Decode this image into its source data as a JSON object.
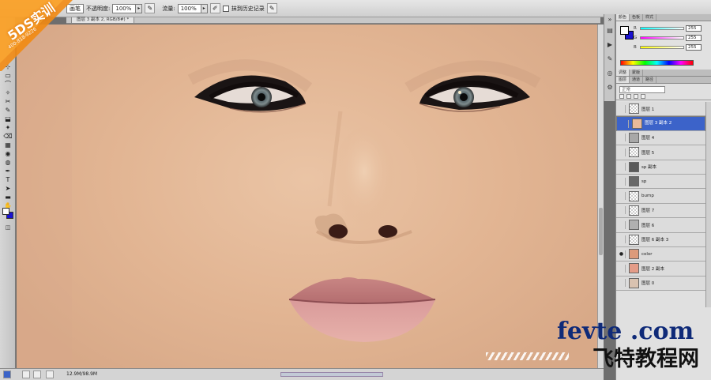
{
  "options_bar": {
    "brush_mode": "画笔",
    "opacity_label": "不透明度:",
    "opacity_value": "100%",
    "flow_label": "流量:",
    "flow_value": "100%",
    "erase_history_label": "抹到历史记录"
  },
  "document": {
    "tab_title": "图层 3 副本 2, RGB/8#) *",
    "status_size": "12.9M/98.9M"
  },
  "color_panel": {
    "tabs": [
      "颜色",
      "色板",
      "样式"
    ],
    "r_label": "R",
    "g_label": "G",
    "b_label": "B",
    "r_value": "255",
    "g_value": "255",
    "b_value": "255",
    "foreground": "#ffffff",
    "background": "#1a12d0"
  },
  "adjust_tabs": [
    "调整",
    "蒙版"
  ],
  "layers_panel": {
    "tabs": [
      "图层",
      "通道",
      "路径"
    ],
    "blend_mode": "正常",
    "layers": [
      {
        "name": "图层 1",
        "visible": false,
        "selected": false,
        "thumb": "transparent"
      },
      {
        "name": "图层 3 副本 2",
        "visible": false,
        "selected": true,
        "thumb": "#e8b99a"
      },
      {
        "name": "图层 4",
        "visible": false,
        "selected": false,
        "thumb": "#a8a8a8"
      },
      {
        "name": "图层 5",
        "visible": false,
        "selected": false,
        "thumb": "transparent"
      },
      {
        "name": "sp 副本",
        "visible": false,
        "selected": false,
        "thumb": "#5a5a5a"
      },
      {
        "name": "sp",
        "visible": false,
        "selected": false,
        "thumb": "#686868"
      },
      {
        "name": "bump",
        "visible": false,
        "selected": false,
        "thumb": "transparent"
      },
      {
        "name": "图层 7",
        "visible": false,
        "selected": false,
        "thumb": "transparent"
      },
      {
        "name": "图层 6",
        "visible": false,
        "selected": false,
        "thumb": "#b0b0b0"
      },
      {
        "name": "图层 6 副本 3",
        "visible": false,
        "selected": false,
        "thumb": "transparent"
      },
      {
        "name": "color",
        "visible": true,
        "selected": false,
        "thumb": "#dc9a7a"
      },
      {
        "name": "图层 2 副本",
        "visible": false,
        "selected": false,
        "thumb": "#e49c88"
      },
      {
        "name": "图层 0",
        "visible": false,
        "selected": false,
        "thumb": "#d9c2b0"
      }
    ]
  },
  "watermarks": {
    "badge_main": "5DS实训",
    "badge_sub": "400-818-9226",
    "site": "fevte .com",
    "site_cn": "飞特教程网"
  },
  "icons": {
    "eye": "●",
    "tools": [
      "⊹",
      "▭",
      "⌒",
      "✧",
      "✂",
      "✎",
      "⬓",
      "✦",
      "⌫",
      "▦",
      "◉",
      "◍",
      "✒",
      "T",
      "➤",
      "▬",
      "✋",
      "⚲"
    ]
  }
}
